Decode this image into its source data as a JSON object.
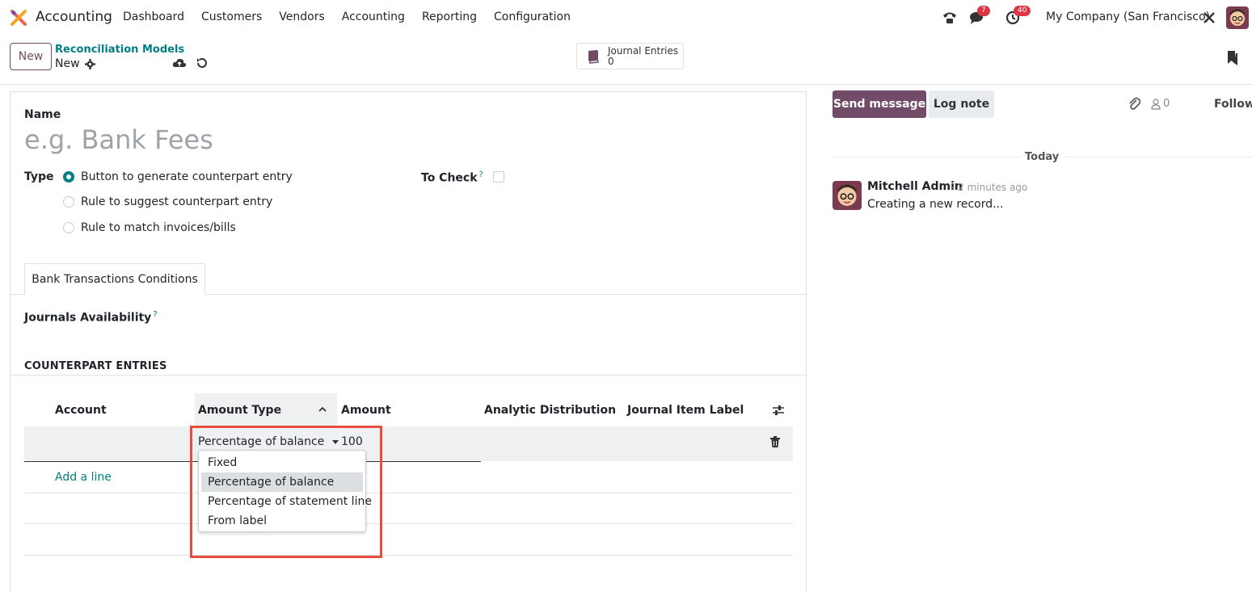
{
  "navbar": {
    "app_name": "Accounting",
    "menu": [
      "Dashboard",
      "Customers",
      "Vendors",
      "Accounting",
      "Reporting",
      "Configuration"
    ],
    "chat_badge": "7",
    "activity_badge": "40",
    "company": "My Company (San Francisco)"
  },
  "control_panel": {
    "new_label": "New",
    "breadcrumb_parent": "Reconciliation Models",
    "breadcrumb_current": "New",
    "smart_button": {
      "label": "Journal Entries",
      "count": "0"
    }
  },
  "form": {
    "name_label": "Name",
    "name_placeholder": "e.g. Bank Fees",
    "type_label": "Type",
    "type_options": [
      "Button to generate counterpart entry",
      "Rule to suggest counterpart entry",
      "Rule to match invoices/bills"
    ],
    "selected_type_index": 0,
    "to_check_label": "To Check",
    "help_mark": "?",
    "tab_label": "Bank Transactions Conditions",
    "journals_label": "Journals Availability",
    "counterpart_title": "COUNTERPART ENTRIES"
  },
  "table": {
    "columns": [
      "Account",
      "Amount Type",
      "Amount",
      "Analytic Distribution",
      "Journal Item Label"
    ],
    "row": {
      "amount_type": "Percentage of balance",
      "amount": "100"
    },
    "add_line": "Add a line"
  },
  "dropdown": {
    "options": [
      "Fixed",
      "Percentage of balance",
      "Percentage of statement line",
      "From label"
    ],
    "selected_index": 1
  },
  "chatter": {
    "send_message": "Send message",
    "log_note": "Log note",
    "followers_count": "0",
    "follow": "Follow",
    "date_separator": "Today",
    "message": {
      "author": "Mitchell Admin",
      "time": "- 2 minutes ago",
      "body": "Creating a new record..."
    }
  },
  "colors": {
    "brand": "#714B67",
    "accent": "#017e84",
    "highlight": "#e74c3c",
    "badge": "#dc3545"
  }
}
